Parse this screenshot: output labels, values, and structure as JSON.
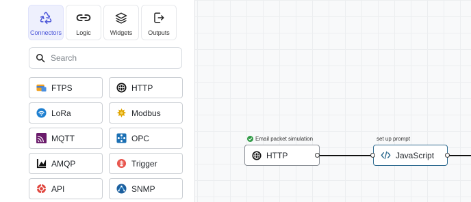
{
  "panel": {
    "tabs": [
      {
        "label": "Connectors",
        "icon": "recycle-icon",
        "active": true
      },
      {
        "label": "Logic",
        "icon": "link-icon",
        "active": false
      },
      {
        "label": "Widgets",
        "icon": "layers-icon",
        "active": false
      },
      {
        "label": "Outputs",
        "icon": "export-icon",
        "active": false
      }
    ],
    "search": {
      "placeholder": "Search",
      "value": ""
    },
    "connectors": [
      {
        "label": "FTPS",
        "icon": "ftps-icon"
      },
      {
        "label": "HTTP",
        "icon": "globe-icon"
      },
      {
        "label": "LoRa",
        "icon": "wifi-icon"
      },
      {
        "label": "Modbus",
        "icon": "modbus-icon"
      },
      {
        "label": "MQTT",
        "icon": "mqtt-icon"
      },
      {
        "label": "OPC",
        "icon": "opc-icon"
      },
      {
        "label": "AMQP",
        "icon": "amqp-icon"
      },
      {
        "label": "Trigger",
        "icon": "trigger-icon"
      },
      {
        "label": "API",
        "icon": "api-icon"
      },
      {
        "label": "SNMP",
        "icon": "snmp-icon"
      }
    ]
  },
  "canvas": {
    "nodes": [
      {
        "label": "HTTP",
        "caption": "Email packet simulation",
        "icon": "globe-icon",
        "status": "success"
      },
      {
        "label": "JavaScript",
        "caption": "set up prompt",
        "icon": "code-icon"
      }
    ]
  },
  "colors": {
    "accent": "#4a54d8",
    "accent_bg": "#eef0fd",
    "node_selected": "#2d6a8f",
    "success": "#2e9a44"
  }
}
